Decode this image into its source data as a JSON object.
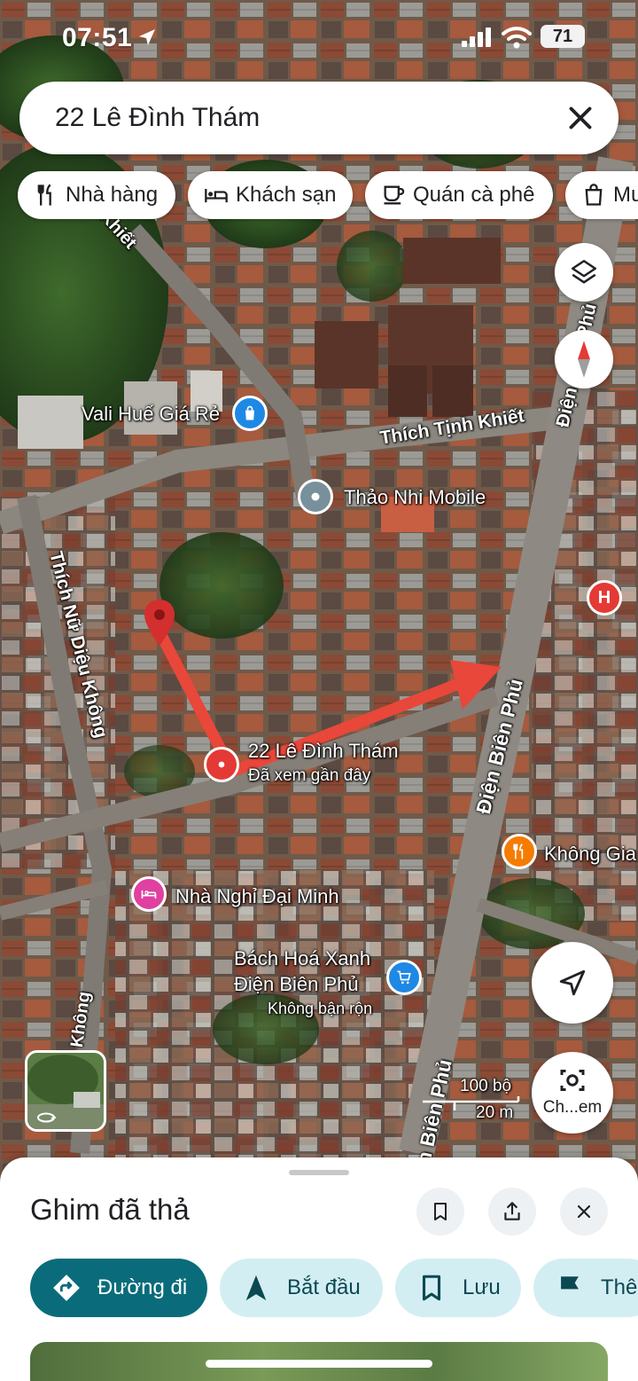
{
  "status_bar": {
    "time": "07:51",
    "battery": "71"
  },
  "search": {
    "query": "22 Lê Đình Thám"
  },
  "chips": [
    {
      "label": "Nhà hàng",
      "icon": "restaurant-icon"
    },
    {
      "label": "Khách sạn",
      "icon": "hotel-icon"
    },
    {
      "label": "Quán cà phê",
      "icon": "coffee-icon"
    },
    {
      "label": "Mu",
      "icon": "shopping-bag-icon"
    }
  ],
  "map": {
    "streets": {
      "thich_tinh_khiet": "Thích Tịnh Khiết",
      "thich_tinh_khiet_top": "Khiết",
      "dien_bien_phu_top": "Điện Biên Phủ",
      "dien_bien_phu_mid": "Điện Biên Phủ",
      "dien_bien_phu_bottom": "n Biên Phủ",
      "thich_nu_dieu_khong": "Thích Nữ Diệu Không",
      "khong_bottom": "Không"
    },
    "places": {
      "vali": "Vali Huế Giá Rẻ",
      "thao_nhi": "Thảo Nhi Mobile",
      "pin_title": "22 Lê Đình Thám",
      "pin_sub": "Đã xem gần đây",
      "khong_gia": "Không Gia",
      "nha_nghi": "Nhà Nghỉ Đại Minh",
      "bach_hoa_1": "Bách Hoá Xanh",
      "bach_hoa_2": "Điện Biên Phủ",
      "bach_hoa_status": "Không bận rộn",
      "hospital_glyph": "H"
    },
    "lens_label": "Ch...em",
    "scale": {
      "feet": "100 bộ",
      "meters": "20 m"
    },
    "colors": {
      "pin_red": "#e53935",
      "annotation_arrow": "#e8473a",
      "shop_blue": "#1e88e5",
      "food_orange": "#f57c00",
      "lodging_pink": "#e040a0"
    }
  },
  "sheet": {
    "title": "Ghim đã thả",
    "buttons": {
      "directions": "Đường đi",
      "start": "Bắt đầu",
      "save": "Lưu",
      "more": "Thên"
    },
    "colors": {
      "primary": "#0a6c7a",
      "secondary": "#d3eef3"
    }
  }
}
